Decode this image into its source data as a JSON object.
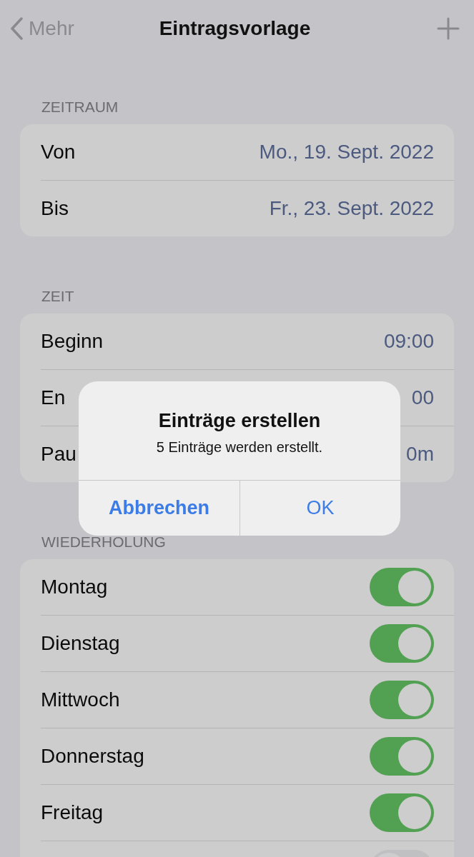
{
  "nav": {
    "back_label": "Mehr",
    "title": "Eintragsvorlage"
  },
  "sections": [
    {
      "header": "ZEITRAUM",
      "rows": [
        {
          "kind": "value",
          "label": "Von",
          "value": "Mo., 19. Sept. 2022"
        },
        {
          "kind": "value",
          "label": "Bis",
          "value": "Fr., 23. Sept. 2022"
        }
      ]
    },
    {
      "header": "ZEIT",
      "rows": [
        {
          "kind": "value",
          "label": "Beginn",
          "value": "09:00"
        },
        {
          "kind": "value",
          "label": "En",
          "value": "00"
        },
        {
          "kind": "value",
          "label": "Pau",
          "value": "0m"
        }
      ]
    },
    {
      "header": "WIEDERHOLUNG",
      "rows": [
        {
          "kind": "toggle",
          "label": "Montag",
          "on": true
        },
        {
          "kind": "toggle",
          "label": "Dienstag",
          "on": true
        },
        {
          "kind": "toggle",
          "label": "Mittwoch",
          "on": true
        },
        {
          "kind": "toggle",
          "label": "Donnerstag",
          "on": true
        },
        {
          "kind": "toggle",
          "label": "Freitag",
          "on": true
        },
        {
          "kind": "toggle",
          "on": false
        }
      ]
    }
  ],
  "alert": {
    "title": "Einträge erstellen",
    "message": "5 Einträge werden erstellt.",
    "cancel": "Abbrechen",
    "confirm": "OK"
  }
}
